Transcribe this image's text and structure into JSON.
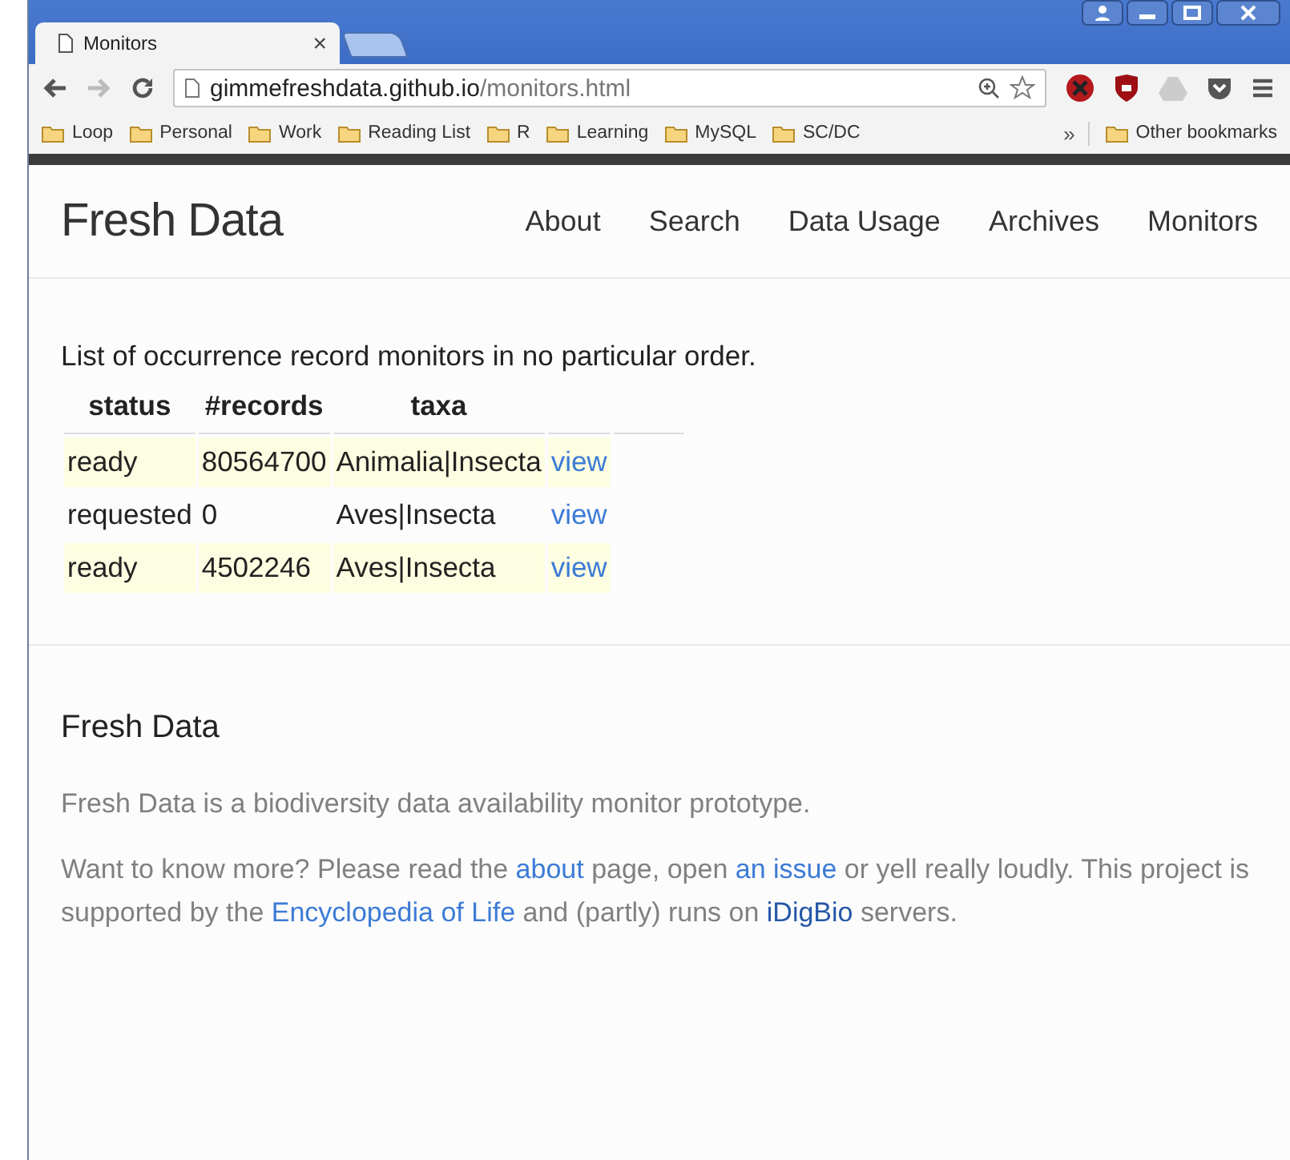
{
  "browser": {
    "tab_title": "Monitors",
    "tab_close": "×",
    "url_host": "gimmefreshdata.github.io",
    "url_path": "/monitors.html",
    "bookmarks": [
      "Loop",
      "Personal",
      "Work",
      "Reading List",
      "R",
      "Learning",
      "MySQL",
      "SC/DC"
    ],
    "more": "»",
    "other_bookmarks": "Other bookmarks"
  },
  "navbar": {
    "brand": "Fresh Data",
    "links": [
      {
        "label": "About"
      },
      {
        "label": "Search"
      },
      {
        "label": "Data Usage"
      },
      {
        "label": "Archives"
      },
      {
        "label": "Monitors"
      }
    ]
  },
  "intro": "List of occurrence record monitors in no particular order.",
  "table": {
    "columns": [
      "status",
      "#records",
      "taxa"
    ],
    "rows": [
      {
        "status": "ready",
        "records": "80564700",
        "taxa": "Animalia|Insecta",
        "link": "view",
        "highlighted": true
      },
      {
        "status": "requested",
        "records": "0",
        "taxa": "Aves|Insecta",
        "link": "view",
        "highlighted": false
      },
      {
        "status": "ready",
        "records": "4502246",
        "taxa": "Aves|Insecta",
        "link": "view",
        "highlighted": true
      }
    ]
  },
  "footer": {
    "title": "Fresh Data",
    "description": "Fresh Data is a biodiversity data availability monitor prototype.",
    "more": [
      {
        "kind": "text",
        "text": "Want to know more? Please read the "
      },
      {
        "kind": "link",
        "text": "about"
      },
      {
        "kind": "text",
        "text": " page, open "
      },
      {
        "kind": "link",
        "text": "an issue"
      },
      {
        "kind": "text",
        "text": " or yell really loudly. This project is supported by the "
      },
      {
        "kind": "link",
        "text": "Encyclopedia of Life"
      },
      {
        "kind": "text",
        "text": " and (partly) runs on "
      },
      {
        "kind": "dark-link",
        "text": "iDigBio"
      },
      {
        "kind": "text",
        "text": " servers."
      }
    ]
  }
}
